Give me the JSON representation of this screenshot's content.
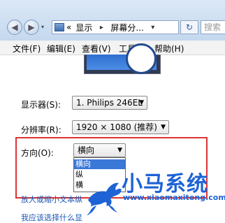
{
  "toolbar": {
    "address_parts": [
      "«",
      "显示",
      "屏幕分..."
    ],
    "search_placeholder": "搜索"
  },
  "menubar": {
    "items": [
      "文件(F)",
      "编辑(E)",
      "查看(V)",
      "工具(T)",
      "帮助(H)"
    ]
  },
  "settings": {
    "display_label": "显示器(S):",
    "display_value": "1. Philips 246EL",
    "resolution_label": "分辨率(R):",
    "resolution_value": "1920 × 1080 (推荐)",
    "orientation_label": "方向(O):",
    "orientation_value": "横向",
    "orientation_options": [
      "横向",
      "纵",
      "横"
    ]
  },
  "links": {
    "enlarge_text": "放大或缩小文本",
    "enlarge_text_tail": "纵",
    "what_display": "我应该选择什么显"
  },
  "watermark": {
    "brand": "小马系统",
    "url": "www.xiaomaxitong.com"
  },
  "colors": {
    "highlight_border": "#dd3333",
    "selection": "#3a78d8",
    "link": "#1b57b7",
    "watermark": "#1d63d6"
  }
}
